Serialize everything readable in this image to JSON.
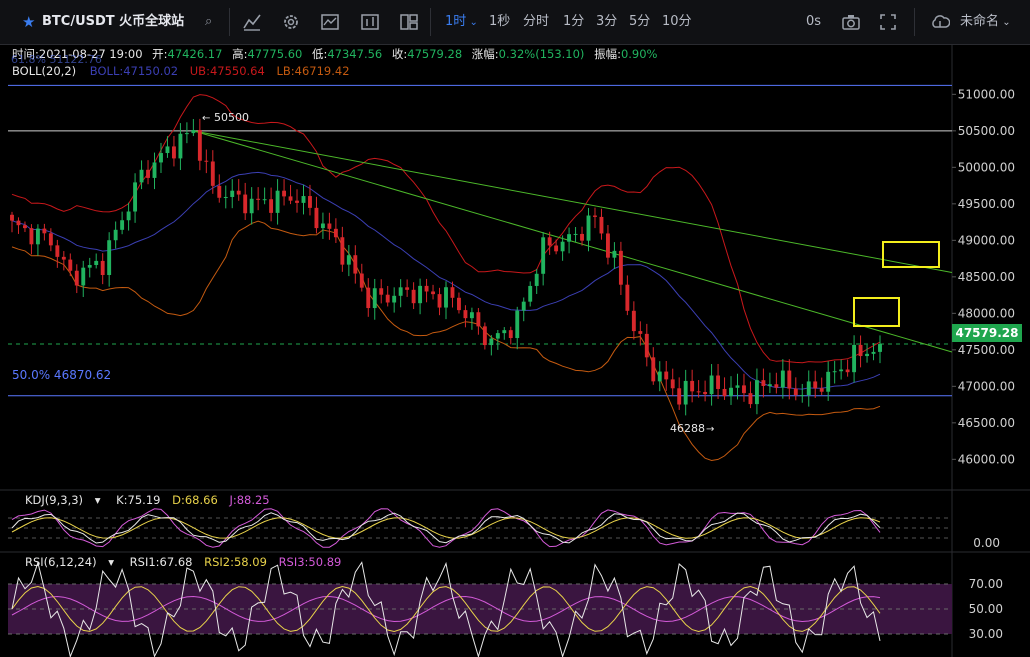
{
  "toolbar": {
    "symbol": "BTC/USDT 火币全球站",
    "interval_active": "1时",
    "intervals": [
      "1秒",
      "分时",
      "1分",
      "3分",
      "5分",
      "10分"
    ],
    "countdown": "0s",
    "layout_name": "未命名"
  },
  "info_bar": {
    "time_label": "时间:",
    "time": "2021-08-27 19:00",
    "open_label": "开:",
    "open": "47426.17",
    "high_label": "高:",
    "high": "47775.60",
    "low_label": "低:",
    "low": "47347.56",
    "close_label": "收:",
    "close": "47579.28",
    "change_label": "涨幅:",
    "change": "0.32%(153.10)",
    "amp_label": "振幅:",
    "amp": "0.90%"
  },
  "boll_legend": {
    "title": "BOLL(20,2)",
    "boll": "BOLL:47150.02",
    "ub": "UB:47550.64",
    "lb": "LB:46719.42"
  },
  "kdj_legend": {
    "title": "KDJ(9,3,3)",
    "k": "K:75.19",
    "d": "D:68.66",
    "j": "J:88.25"
  },
  "rsi_legend": {
    "title": "RSI(6,12,24)",
    "r1": "RSI1:67.68",
    "r2": "RSI2:58.09",
    "r3": "RSI3:50.89"
  },
  "colors": {
    "up": "#21b35f",
    "down": "#d8282c",
    "boll_mid": "#3b3fb3",
    "boll_ub": "#c8181b",
    "boll_lb": "#c45a10",
    "trend": "#4cb82a",
    "fib": "#5a78ff",
    "highlight": "#f3ee1c",
    "price_tag": "#1fa64e",
    "kdj_k": "#e8e8e8",
    "kdj_d": "#e8d24a",
    "kdj_j": "#d35ad8",
    "rsi1": "#e8e8e8",
    "rsi2": "#e8d24a",
    "rsi3": "#d35ad8",
    "rsi_band": "#3a1540"
  },
  "chart_data": {
    "type": "candlestick",
    "interval": "1h",
    "y_axis": {
      "ticks": [
        "51000.00",
        "50500.00",
        "50000.00",
        "49500.00",
        "49000.00",
        "48500.00",
        "48000.00",
        "47500.00",
        "47000.00",
        "46500.00",
        "46000.00"
      ],
      "range": [
        45580,
        51580
      ]
    },
    "last_price_label": "47579.28",
    "last_price": 47579.28,
    "annotations": [
      {
        "text": "50500",
        "price": 50500
      },
      {
        "text": "46288",
        "price": 46288
      },
      {
        "text": "61.8% 51122.76",
        "price": 51122.76
      },
      {
        "text": "50.0% 46870.62",
        "price": 46870.62
      }
    ],
    "kdj": {
      "k": 75.19,
      "d": 68.66,
      "j": 88.25,
      "ticks": [
        "0.00"
      ]
    },
    "rsi": {
      "rsi1": 67.68,
      "rsi2": 58.09,
      "rsi3": 50.89,
      "ticks": [
        "70.00",
        "50.00",
        "30.00"
      ]
    }
  }
}
